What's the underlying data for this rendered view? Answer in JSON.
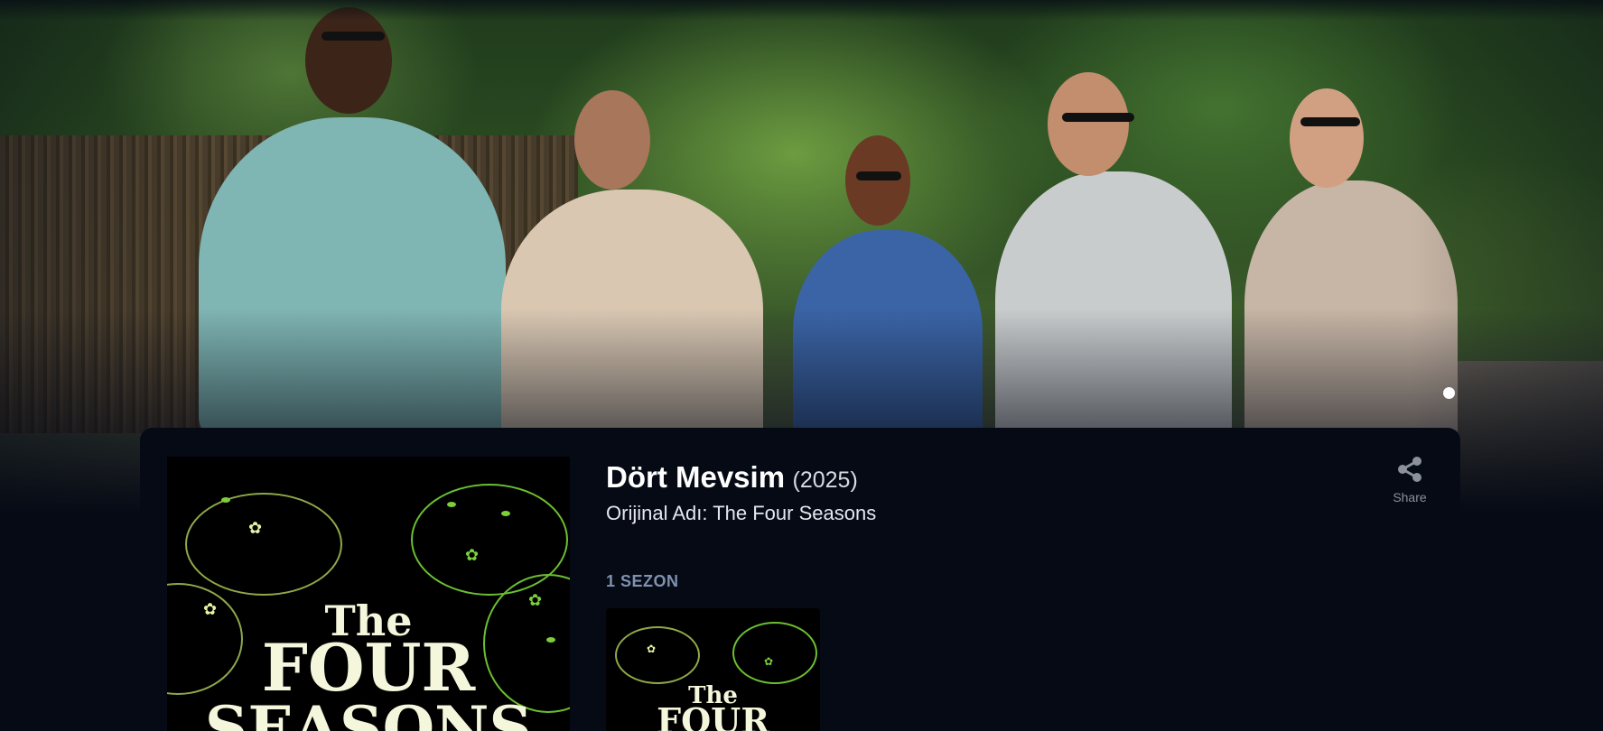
{
  "show": {
    "title": "Dört Mevsim",
    "year": "(2025)",
    "original_title": "Orijinal Adı: The Four Seasons"
  },
  "actions": {
    "share_label": "Share",
    "share_icon": "share-icon"
  },
  "seasons": {
    "label": "1 SEZON"
  },
  "poster": {
    "line1": "The",
    "line2": "FOUR",
    "line3": "SEASONS"
  },
  "season_thumb": {
    "line1": "The",
    "line2": "FOUR"
  },
  "colors": {
    "background": "#050a14",
    "accent_label": "#7f91b0",
    "poster_text": "#f5f7dc",
    "vine_green": "#7ccf3a"
  },
  "carousel": {
    "active_index": 1,
    "total_visible_dots": 1
  }
}
